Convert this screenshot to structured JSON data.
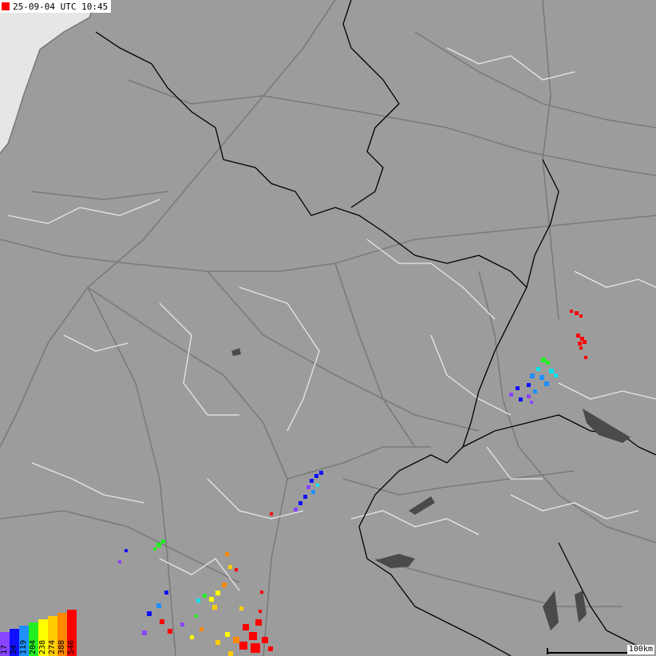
{
  "header": {
    "timestamp": "25-09-04 UTC 10:45"
  },
  "scale": {
    "label": "100km"
  },
  "legend": {
    "items": [
      {
        "label": "17",
        "color": "#8844ff"
      },
      {
        "label": "34",
        "color": "#1010ff"
      },
      {
        "label": "119",
        "color": "#1e90ff"
      },
      {
        "label": "204",
        "color": "#22ee22"
      },
      {
        "label": "238",
        "color": "#ffff00"
      },
      {
        "label": "274",
        "color": "#ffcc00"
      },
      {
        "label": "388",
        "color": "#ff8800"
      },
      {
        "label": "546",
        "color": "#ff0000"
      }
    ]
  },
  "colors": {
    "land": "#9c9c9c",
    "sea": "#e6e6e6",
    "lake": "#4a4a4a",
    "roads": "#7a7a7a",
    "regional_borders": "#e8e8e8",
    "national_borders": "#000000"
  }
}
